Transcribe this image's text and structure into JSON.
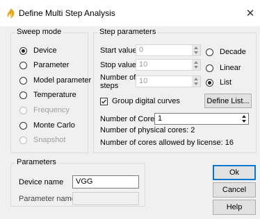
{
  "window": {
    "title": "Define Multi Step Analysis",
    "close_glyph": "✕"
  },
  "sweep_mode": {
    "title": "Sweep mode",
    "options": [
      {
        "label": "Device",
        "checked": true,
        "enabled": true
      },
      {
        "label": "Parameter",
        "checked": false,
        "enabled": true
      },
      {
        "label": "Model parameter",
        "checked": false,
        "enabled": true
      },
      {
        "label": "Temperature",
        "checked": false,
        "enabled": true
      },
      {
        "label": "Frequency",
        "checked": false,
        "enabled": false
      },
      {
        "label": "Monte Carlo",
        "checked": false,
        "enabled": true
      },
      {
        "label": "Snapshot",
        "checked": false,
        "enabled": false
      }
    ]
  },
  "step_parameters": {
    "title": "Step parameters",
    "start_label": "Start value",
    "start_value": "0",
    "stop_label": "Stop value",
    "stop_value": "10",
    "number_label_line1": "Number of",
    "number_label_line2": "steps",
    "number_value": "10",
    "scale_options": [
      {
        "label": "Decade",
        "checked": false
      },
      {
        "label": "Linear",
        "checked": false
      },
      {
        "label": "List",
        "checked": true
      }
    ],
    "group_digital_label": "Group digital curves",
    "group_digital_checked": true,
    "define_list_label": "Define List...",
    "cores_label": "Number of Cores",
    "cores_value": "1",
    "physical_cores_text": "Number of physical cores: 2",
    "licensed_cores_text": "Number of cores allowed by license: 16"
  },
  "parameters": {
    "title": "Parameters",
    "device_name_label": "Device name",
    "device_name_value": "VGG",
    "parameter_name_label": "Parameter name",
    "parameter_name_value": ""
  },
  "buttons": {
    "ok": "Ok",
    "cancel": "Cancel",
    "help": "Help"
  },
  "colors": {
    "icon_flame": "#e8a21a",
    "accent": "#0078d7"
  },
  "icons": {
    "app": "flame-icon",
    "close": "close-icon"
  }
}
